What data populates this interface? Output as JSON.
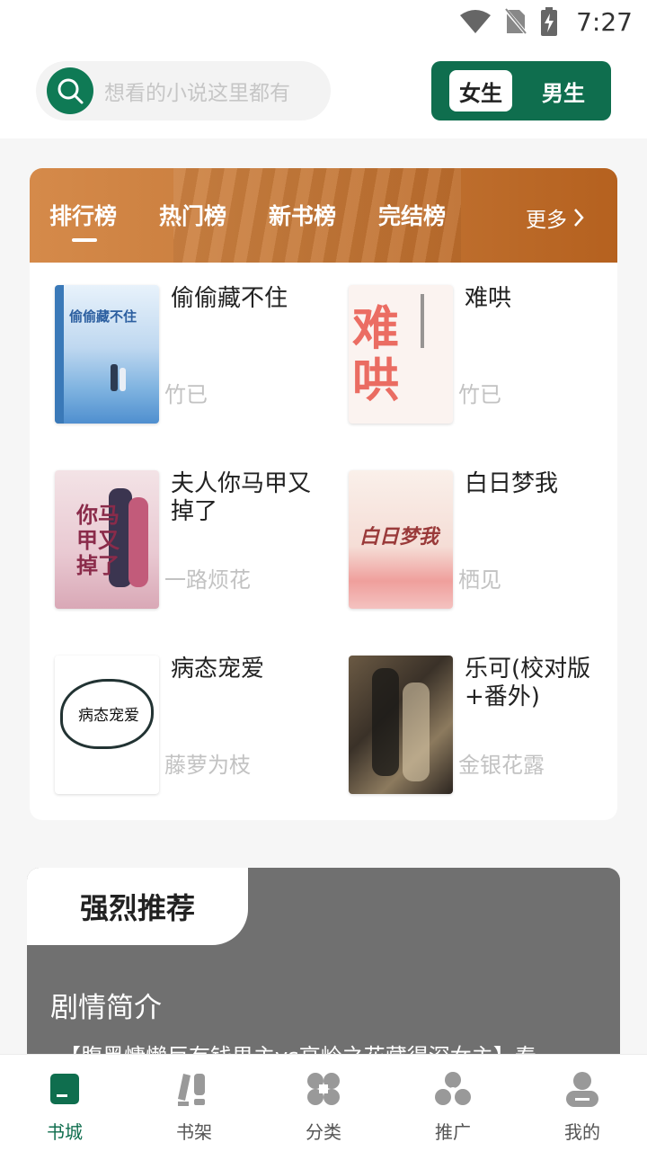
{
  "status": {
    "time": "7:27"
  },
  "search": {
    "placeholder": "想看的小说这里都有"
  },
  "gender": {
    "female": "女生",
    "male": "男生"
  },
  "rank": {
    "tabs": [
      "排行榜",
      "热门榜",
      "新书榜",
      "完结榜"
    ],
    "more": "更多",
    "books": [
      {
        "title": "偷偷藏不住",
        "author": "竹已",
        "cover_text": "偷偷藏不住"
      },
      {
        "title": "难哄",
        "author": "竹已",
        "cover_text": "难哄"
      },
      {
        "title": "夫人你马甲又掉了",
        "author": "一路烦花",
        "cover_text": "你马甲又掉了"
      },
      {
        "title": "白日梦我",
        "author": "栖见",
        "cover_text": "白日梦我"
      },
      {
        "title": "病态宠爱",
        "author": "藤萝为枝",
        "cover_text": "病态宠爱"
      },
      {
        "title": "乐可(校对版+番外)",
        "author": "金银花露",
        "cover_text": ""
      }
    ]
  },
  "recommend": {
    "tab": "强烈推荐",
    "plot_title": "剧情简介",
    "plot_text": "【腹黑慵懒巨有钱男主vs高岭之花藏得深女主】春"
  },
  "nav": {
    "items": [
      {
        "label": "书城",
        "icon": "book-store-icon"
      },
      {
        "label": "书架",
        "icon": "bookshelf-icon"
      },
      {
        "label": "分类",
        "icon": "category-icon"
      },
      {
        "label": "推广",
        "icon": "share-icon"
      },
      {
        "label": "我的",
        "icon": "profile-icon"
      }
    ]
  },
  "colors": {
    "brand": "#0f6e4e",
    "banner": "#c67a3a",
    "recommend_bg": "#707070"
  }
}
